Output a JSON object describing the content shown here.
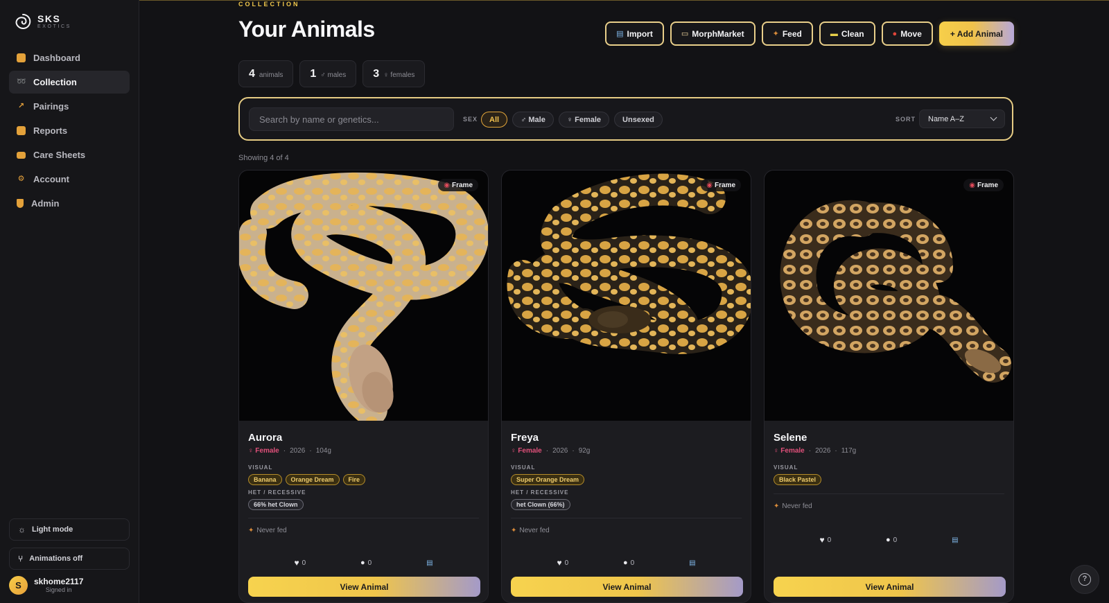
{
  "brand": {
    "name": "SKS",
    "subtitle": "EXOTICS"
  },
  "sidebar": {
    "items": [
      {
        "label": "Dashboard",
        "icon": "dashboard-icon",
        "active": false
      },
      {
        "label": "Collection",
        "icon": "snake-icon",
        "active": true
      },
      {
        "label": "Pairings",
        "icon": "pairing-icon",
        "active": false
      },
      {
        "label": "Reports",
        "icon": "reports-icon",
        "active": false
      },
      {
        "label": "Care Sheets",
        "icon": "care-sheet-icon",
        "active": false
      },
      {
        "label": "Account",
        "icon": "gear-icon",
        "active": false
      },
      {
        "label": "Admin",
        "icon": "shield-icon",
        "active": false
      }
    ],
    "light_mode_label": "Light mode",
    "animations_label": "Animations off",
    "user": {
      "initial": "S",
      "name": "skhome2117",
      "status": "Signed in"
    }
  },
  "header": {
    "eyebrow": "COLLECTION",
    "title": "Your Animals",
    "actions": [
      {
        "label": "Import",
        "icon": "inbox-tray-icon"
      },
      {
        "label": "MorphMarket",
        "icon": "ticket-icon"
      },
      {
        "label": "Feed",
        "icon": "drumstick-icon"
      },
      {
        "label": "Clean",
        "icon": "sponge-icon"
      },
      {
        "label": "Move",
        "icon": "pin-icon"
      }
    ],
    "add_label": "+ Add Animal"
  },
  "stats": [
    {
      "value": "4",
      "label": "animals"
    },
    {
      "value": "1",
      "label": "♂ males"
    },
    {
      "value": "3",
      "label": "♀ females"
    }
  ],
  "filters": {
    "search_placeholder": "Search by name or genetics...",
    "sex_label": "SEX",
    "sex_options": [
      {
        "label": "All",
        "active": true
      },
      {
        "label": "♂ Male",
        "active": false
      },
      {
        "label": "♀ Female",
        "active": false
      },
      {
        "label": "Unsexed",
        "active": false
      }
    ],
    "sort_label": "SORT",
    "sort_value": "Name A–Z"
  },
  "showing": "Showing 4 of 4",
  "cards": [
    {
      "badge": "Frame",
      "name": "Aurora",
      "sex": "Female",
      "year": "2026",
      "weight": "104g",
      "visual_label": "VISUAL",
      "visual_tags": [
        "Banana",
        "Orange Dream",
        "Fire"
      ],
      "het_label": "HET / RECESSIVE",
      "het_tags": [
        "66% het Clown"
      ],
      "fed": "Never fed",
      "likes": "0",
      "comments": "0",
      "button": "View Animal"
    },
    {
      "badge": "Frame",
      "name": "Freya",
      "sex": "Female",
      "year": "2026",
      "weight": "92g",
      "visual_label": "VISUAL",
      "visual_tags": [
        "Super Orange Dream"
      ],
      "het_label": "HET / RECESSIVE",
      "het_tags": [
        "het Clown (66%)"
      ],
      "fed": "Never fed",
      "likes": "0",
      "comments": "0",
      "button": "View Animal"
    },
    {
      "badge": "Frame",
      "name": "Selene",
      "sex": "Female",
      "year": "2026",
      "weight": "117g",
      "visual_label": "VISUAL",
      "visual_tags": [
        "Black Pastel"
      ],
      "het_label": "",
      "het_tags": [],
      "fed": "Never fed",
      "likes": "0",
      "comments": "0",
      "button": "View Animal"
    }
  ],
  "colors": {
    "accent": "#f2c94c",
    "background": "#121215",
    "female": "#e0507a",
    "gradient_end": "#a49ac8"
  }
}
